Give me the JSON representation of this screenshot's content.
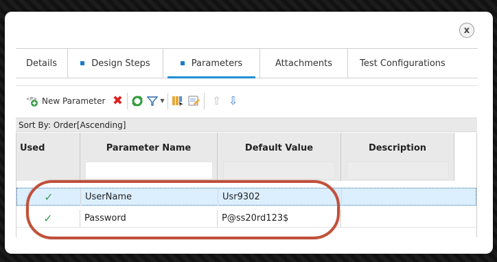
{
  "dialog": {
    "close_label": "x"
  },
  "tabs": [
    {
      "label": "Details",
      "dot": false,
      "active": false
    },
    {
      "label": "Design Steps",
      "dot": true,
      "active": false
    },
    {
      "label": "Parameters",
      "dot": true,
      "active": true
    },
    {
      "label": "Attachments",
      "dot": false,
      "active": false
    },
    {
      "label": "Test Configurations",
      "dot": false,
      "active": false
    }
  ],
  "toolbar": {
    "new_parameter_label": "New Parameter",
    "icons": [
      "new-parameter-icon",
      "delete-icon",
      "refresh-icon",
      "filter-icon",
      "columns-icon",
      "edit-icon",
      "move-up-icon",
      "move-down-icon"
    ]
  },
  "sort": {
    "text": "Sort By: Order[Ascending]"
  },
  "grid": {
    "columns": [
      "Used",
      "Parameter Name",
      "Default Value",
      "Description"
    ],
    "rows": [
      {
        "used": "✓",
        "name": "UserName",
        "value": "Usr9302",
        "description": "",
        "selected": true
      },
      {
        "used": "✓",
        "name": "Password",
        "value": "P@ss20rd123$",
        "description": "",
        "selected": false
      }
    ]
  },
  "colors": {
    "accent": "#1e8fd6",
    "check": "#3d9c55",
    "highlight": "#c0503a",
    "selection": "#dcefff"
  }
}
